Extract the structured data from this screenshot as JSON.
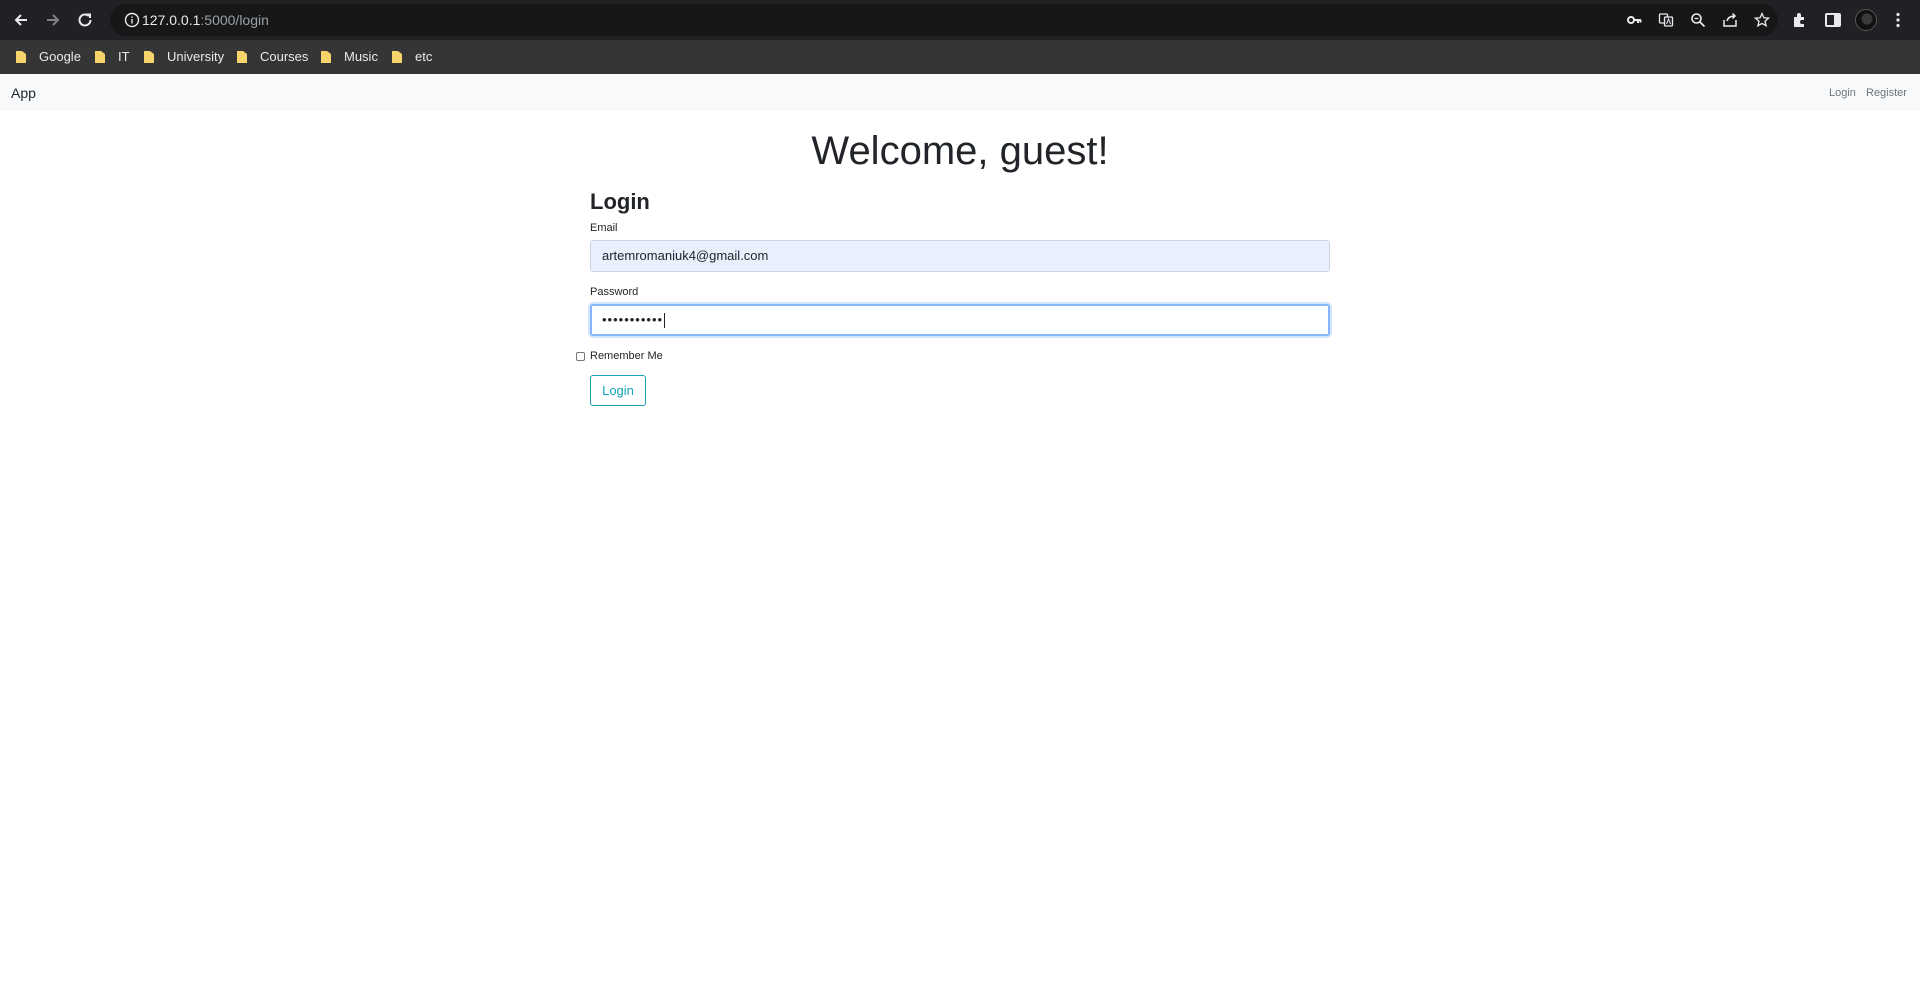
{
  "browser": {
    "url_host": "127.0.0.1",
    "url_path": ":5000/login",
    "bookmarks": [
      "Google",
      "IT",
      "University",
      "Courses",
      "Music",
      "etc"
    ]
  },
  "navbar": {
    "brand": "App",
    "links": [
      "Login",
      "Register"
    ]
  },
  "page": {
    "welcome": "Welcome, guest!",
    "form_title": "Login",
    "email_label": "Email",
    "email_value": "artemromaniuk4@gmail.com",
    "password_label": "Password",
    "password_value": "•••••••••••",
    "remember_label": "Remember Me",
    "submit_label": "Login"
  },
  "colors": {
    "accent": "#17a2b8",
    "chrome_dark": "#202124",
    "bookmarks_bar": "#353535",
    "navbar_bg": "#f8f9fa",
    "autofill_bg": "#e8f0fe",
    "focus_border": "#86b7fe"
  },
  "icons": [
    "back-icon",
    "forward-icon",
    "reload-icon",
    "info-icon",
    "key-icon",
    "translate-icon",
    "zoom-icon",
    "share-icon",
    "star-icon",
    "extensions-icon",
    "side-panel-icon",
    "menu-icon",
    "folder-icon"
  ]
}
